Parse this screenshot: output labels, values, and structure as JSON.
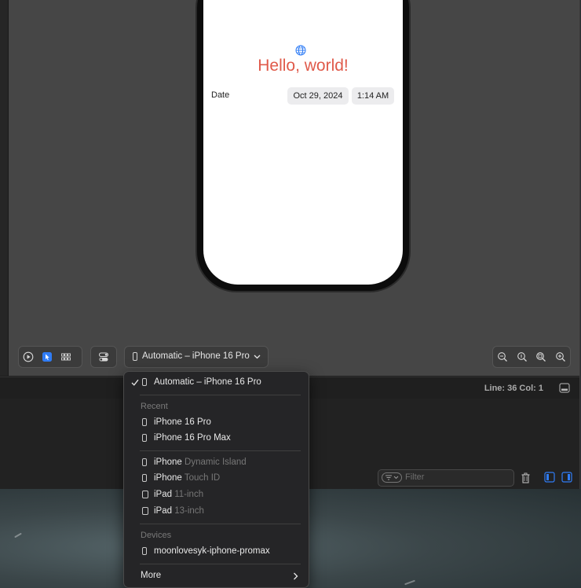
{
  "preview": {
    "hello_text": "Hello, world!",
    "date_label": "Date",
    "date_value": "Oct 29, 2024",
    "time_value": "1:14 AM"
  },
  "toolbar": {
    "device_selector_label": "Automatic – iPhone 16 Pro"
  },
  "status": {
    "line_col": "Line: 36  Col: 1"
  },
  "console": {
    "filter_placeholder": "Filter"
  },
  "device_menu": {
    "selected_item": "Automatic – iPhone 16 Pro",
    "recent_header": "Recent",
    "recent": [
      "iPhone 16 Pro",
      "iPhone 16 Pro Max"
    ],
    "families": [
      {
        "name": "iPhone",
        "detail": "Dynamic Island"
      },
      {
        "name": "iPhone",
        "detail": "Touch ID"
      },
      {
        "name": "iPad",
        "detail": "11-inch"
      },
      {
        "name": "iPad",
        "detail": "13-inch"
      }
    ],
    "devices_header": "Devices",
    "devices": [
      "moonlovesyk-iphone-promax"
    ],
    "more_label": "More"
  },
  "colors": {
    "hello_text": "#e05a4a",
    "accent_blue": "#2f7cf6",
    "canvas_bg": "#464646"
  }
}
